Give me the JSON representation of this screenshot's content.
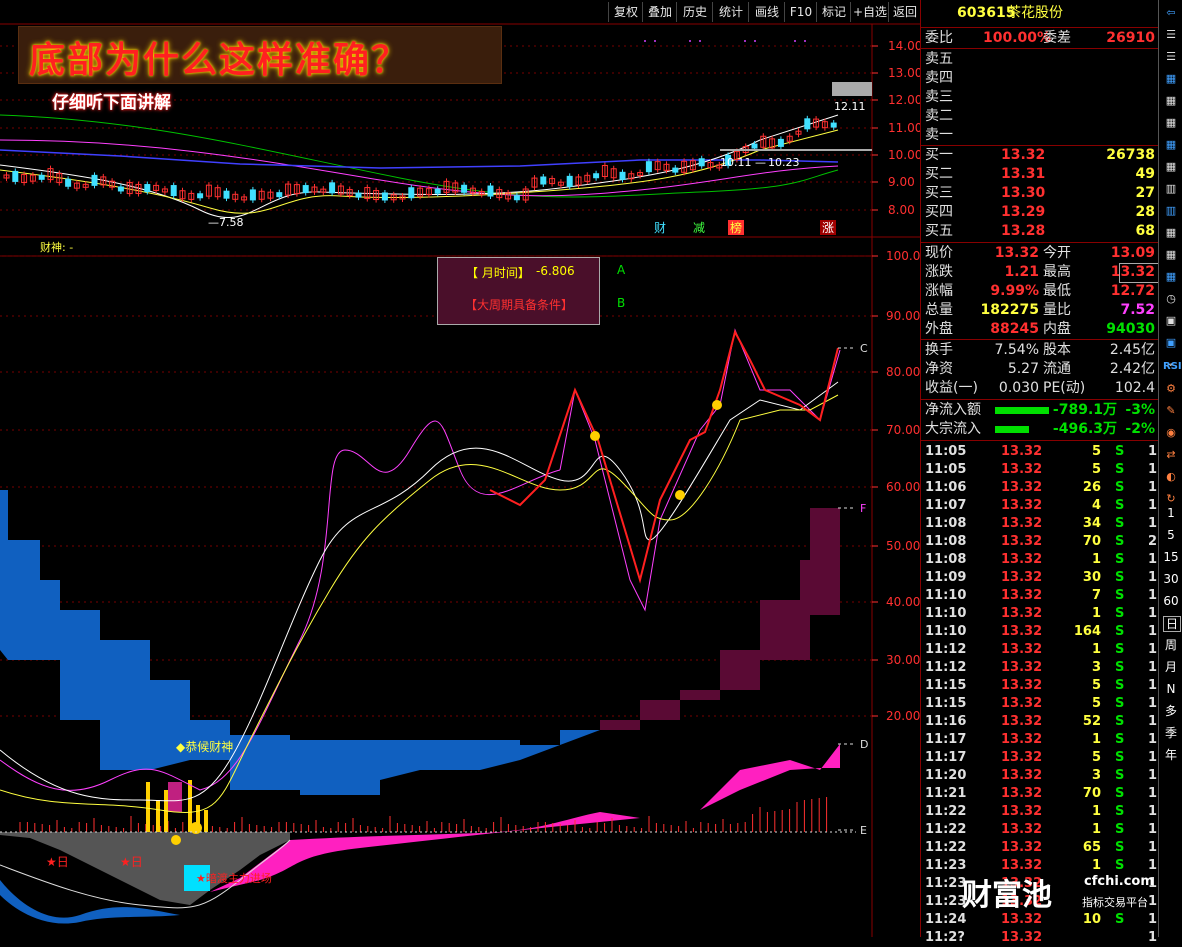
{
  "toolbar": {
    "buttons": [
      "复权",
      "叠加",
      "历史",
      "统计",
      "画线",
      "F10",
      "标记",
      "+自选",
      "返回"
    ]
  },
  "banner": {
    "title": "底部为什么这样准确？",
    "subtitle": "仔细听下面讲解"
  },
  "main_chart": {
    "price_axis": [
      "14.00",
      "13.00",
      "12.00",
      "11.00",
      "10.00",
      "9.00",
      "8.00"
    ],
    "annotations": {
      "low": "7.58",
      "high": "12.11",
      "left_level": "10.11",
      "right_level": "10.23"
    },
    "markers": [
      "财",
      "减",
      "榜",
      "涨"
    ]
  },
  "indicator": {
    "label": "财神: -",
    "info_box": {
      "row1_label": "【 月时间】",
      "row1_value": "-6.806",
      "row1_tag": "A",
      "row2_label": "【大周期具备条件】",
      "row2_tag": "B"
    },
    "axis": [
      "100.0",
      "90.00",
      "80.00",
      "70.00",
      "60.00",
      "50.00",
      "40.00",
      "30.00",
      "20.00"
    ],
    "line_tags": [
      "C",
      "F",
      "D",
      "E"
    ],
    "text_labels": {
      "god": "◆恭候财神",
      "star1": "★日",
      "star2": "★日",
      "star3": "★暗渡主力进场"
    }
  },
  "quote": {
    "code": "603615",
    "name": "茶花股份",
    "webi_label": "委比",
    "webi_value": "100.00%",
    "weicha_label": "委差",
    "weicha_value": "26910",
    "sell": [
      {
        "label": "卖五"
      },
      {
        "label": "卖四"
      },
      {
        "label": "卖三"
      },
      {
        "label": "卖二"
      },
      {
        "label": "卖一"
      }
    ],
    "buy": [
      {
        "label": "买一",
        "price": "13.32",
        "vol": "26738"
      },
      {
        "label": "买二",
        "price": "13.31",
        "vol": "49"
      },
      {
        "label": "买三",
        "price": "13.30",
        "vol": "27"
      },
      {
        "label": "买四",
        "price": "13.29",
        "vol": "28"
      },
      {
        "label": "买五",
        "price": "13.28",
        "vol": "68"
      }
    ],
    "stats": [
      {
        "l1": "现价",
        "v1": "13.32",
        "l2": "今开",
        "v2": "13.09"
      },
      {
        "l1": "涨跌",
        "v1": "1.21",
        "l2": "最高",
        "v2": "13.32"
      },
      {
        "l1": "涨幅",
        "v1": "9.99%",
        "l2": "最低",
        "v2": "12.72"
      },
      {
        "l1": "总量",
        "v1": "182275",
        "l2": "量比",
        "v2": "7.52"
      },
      {
        "l1": "外盘",
        "v1": "88245",
        "l2": "内盘",
        "v2": "94030"
      }
    ],
    "stats2": [
      {
        "l1": "换手",
        "v1": "7.54%",
        "l2": "股本",
        "v2": "2.45亿"
      },
      {
        "l1": "净资",
        "v1": "5.27",
        "l2": "流通",
        "v2": "2.42亿"
      },
      {
        "l1": "收益(一)",
        "v1": "0.030",
        "l2": "PE(动)",
        "v2": "102.4"
      }
    ],
    "flow": [
      {
        "label": "净流入额",
        "value": "-789.1万",
        "pct": "-3%"
      },
      {
        "label": "大宗流入",
        "value": "-496.3万",
        "pct": "-2%"
      }
    ],
    "ticks": [
      {
        "t": "11:05",
        "p": "13.32",
        "v": "5",
        "s": "S",
        "n": "1"
      },
      {
        "t": "11:05",
        "p": "13.32",
        "v": "5",
        "s": "S",
        "n": "1"
      },
      {
        "t": "11:06",
        "p": "13.32",
        "v": "26",
        "s": "S",
        "n": "1"
      },
      {
        "t": "11:07",
        "p": "13.32",
        "v": "4",
        "s": "S",
        "n": "1"
      },
      {
        "t": "11:08",
        "p": "13.32",
        "v": "34",
        "s": "S",
        "n": "1"
      },
      {
        "t": "11:08",
        "p": "13.32",
        "v": "70",
        "s": "S",
        "n": "2"
      },
      {
        "t": "11:08",
        "p": "13.32",
        "v": "1",
        "s": "S",
        "n": "1"
      },
      {
        "t": "11:09",
        "p": "13.32",
        "v": "30",
        "s": "S",
        "n": "1"
      },
      {
        "t": "11:10",
        "p": "13.32",
        "v": "7",
        "s": "S",
        "n": "1"
      },
      {
        "t": "11:10",
        "p": "13.32",
        "v": "1",
        "s": "S",
        "n": "1"
      },
      {
        "t": "11:10",
        "p": "13.32",
        "v": "164",
        "s": "S",
        "n": "1"
      },
      {
        "t": "11:12",
        "p": "13.32",
        "v": "1",
        "s": "S",
        "n": "1"
      },
      {
        "t": "11:12",
        "p": "13.32",
        "v": "3",
        "s": "S",
        "n": "1"
      },
      {
        "t": "11:15",
        "p": "13.32",
        "v": "5",
        "s": "S",
        "n": "1"
      },
      {
        "t": "11:15",
        "p": "13.32",
        "v": "5",
        "s": "S",
        "n": "1"
      },
      {
        "t": "11:16",
        "p": "13.32",
        "v": "52",
        "s": "S",
        "n": "1"
      },
      {
        "t": "11:17",
        "p": "13.32",
        "v": "1",
        "s": "S",
        "n": "1"
      },
      {
        "t": "11:17",
        "p": "13.32",
        "v": "5",
        "s": "S",
        "n": "1"
      },
      {
        "t": "11:20",
        "p": "13.32",
        "v": "3",
        "s": "S",
        "n": "1"
      },
      {
        "t": "11:21",
        "p": "13.32",
        "v": "70",
        "s": "S",
        "n": "1"
      },
      {
        "t": "11:22",
        "p": "13.32",
        "v": "1",
        "s": "S",
        "n": "1"
      },
      {
        "t": "11:22",
        "p": "13.32",
        "v": "1",
        "s": "S",
        "n": "1"
      },
      {
        "t": "11:22",
        "p": "13.32",
        "v": "65",
        "s": "S",
        "n": "1"
      },
      {
        "t": "11:23",
        "p": "13.32",
        "v": "1",
        "s": "S",
        "n": "1"
      },
      {
        "t": "11:23",
        "p": "13.32",
        "v": "",
        "s": "",
        "n": "1"
      },
      {
        "t": "11:23",
        "p": "13.32",
        "v": "",
        "s": "",
        "n": "1"
      },
      {
        "t": "11:24",
        "p": "13.32",
        "v": "10",
        "s": "S",
        "n": "1"
      },
      {
        "t": "11:2?",
        "p": "13.32",
        "v": "",
        "s": "",
        "n": "1"
      }
    ]
  },
  "sidebar": {
    "periods": [
      "1",
      "5",
      "15",
      "30",
      "60",
      "日",
      "周",
      "月",
      "N",
      "多",
      "季",
      "年"
    ],
    "icons": [
      "RSI"
    ]
  },
  "watermark": {
    "logo": "财富池",
    "domain": "cfchi.com",
    "tagline": "指标交易平台"
  }
}
